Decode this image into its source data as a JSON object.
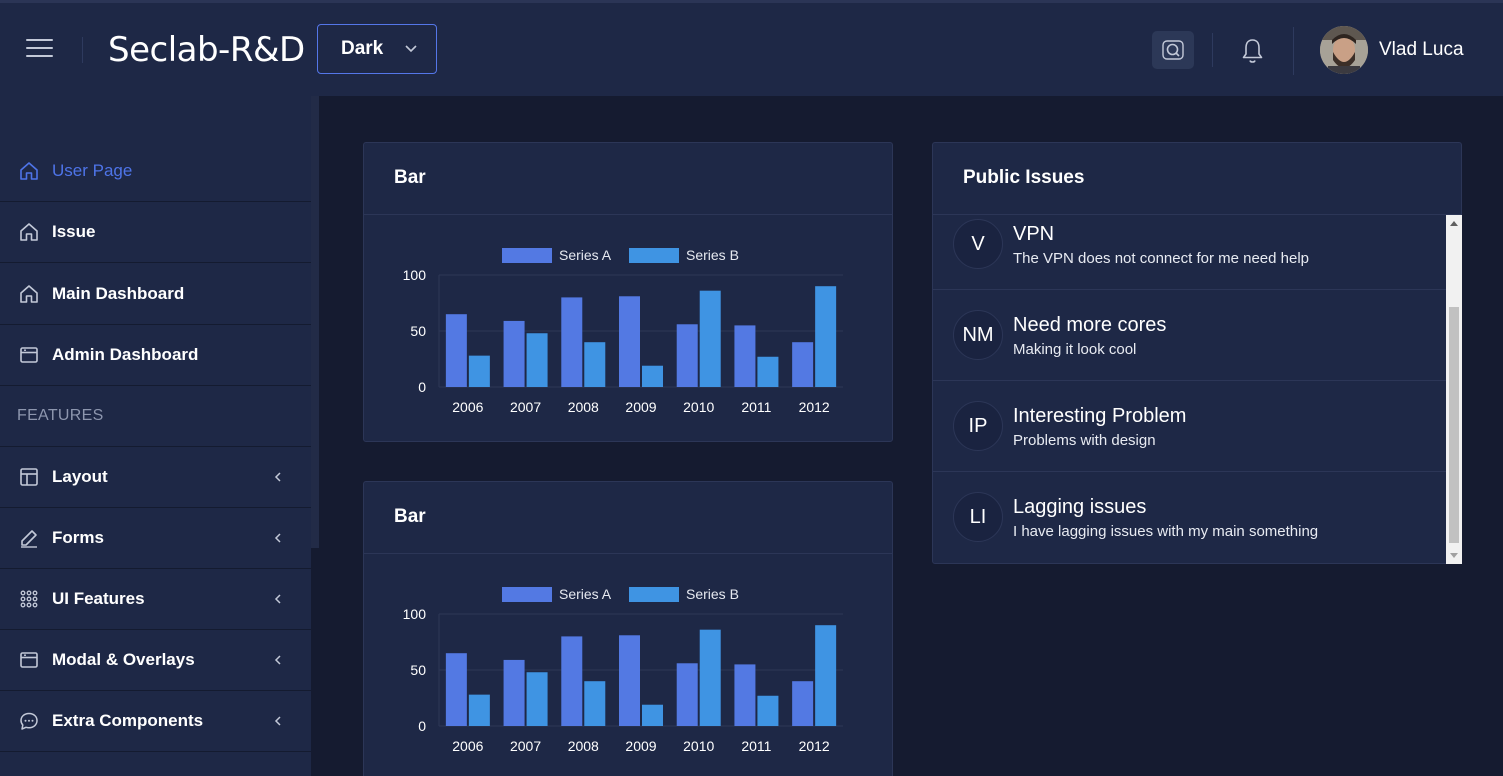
{
  "header": {
    "brand": "Seclab-R&D",
    "theme_select": "Dark",
    "username": "Vlad Luca"
  },
  "sidebar": {
    "items": [
      {
        "label": "User Page",
        "icon": "home-icon",
        "active": true
      },
      {
        "label": "Issue",
        "icon": "home-icon"
      },
      {
        "label": "Main Dashboard",
        "icon": "home-icon"
      },
      {
        "label": "Admin Dashboard",
        "icon": "window-icon"
      }
    ],
    "section_label": "FEATURES",
    "feature_items": [
      {
        "label": "Layout",
        "icon": "layout-icon"
      },
      {
        "label": "Forms",
        "icon": "pencil-icon"
      },
      {
        "label": "UI Features",
        "icon": "grid-dots-icon"
      },
      {
        "label": "Modal & Overlays",
        "icon": "window-icon"
      },
      {
        "label": "Extra Components",
        "icon": "chat-icon"
      }
    ]
  },
  "cards": {
    "bar1_title": "Bar",
    "bar2_title": "Bar",
    "issues_title": "Public Issues"
  },
  "issues": [
    {
      "initials": "V",
      "title": "VPN",
      "desc": "The VPN does not connect for me need help"
    },
    {
      "initials": "NM",
      "title": "Need more cores",
      "desc": "Making it look cool"
    },
    {
      "initials": "IP",
      "title": "Interesting Problem",
      "desc": "Problems with design"
    },
    {
      "initials": "LI",
      "title": "Lagging issues",
      "desc": "I have lagging issues with my main something"
    }
  ],
  "chart_data": [
    {
      "type": "bar",
      "title": "Bar",
      "categories": [
        "2006",
        "2007",
        "2008",
        "2009",
        "2010",
        "2011",
        "2012"
      ],
      "series": [
        {
          "name": "Series A",
          "values": [
            65,
            59,
            80,
            81,
            56,
            55,
            40
          ]
        },
        {
          "name": "Series B",
          "values": [
            28,
            48,
            40,
            19,
            86,
            27,
            90
          ]
        }
      ],
      "ylim": [
        0,
        100
      ],
      "yticks": [
        0,
        50,
        100
      ],
      "legend": "top",
      "colors": [
        "#5379e3",
        "#3f94e3"
      ]
    },
    {
      "type": "bar",
      "title": "Bar",
      "categories": [
        "2006",
        "2007",
        "2008",
        "2009",
        "2010",
        "2011",
        "2012"
      ],
      "series": [
        {
          "name": "Series A",
          "values": [
            65,
            59,
            80,
            81,
            56,
            55,
            40
          ]
        },
        {
          "name": "Series B",
          "values": [
            28,
            48,
            40,
            19,
            86,
            27,
            90
          ]
        }
      ],
      "ylim": [
        0,
        100
      ],
      "yticks": [
        0,
        50,
        100
      ],
      "legend": "top",
      "colors": [
        "#5379e3",
        "#3f94e3"
      ]
    }
  ]
}
